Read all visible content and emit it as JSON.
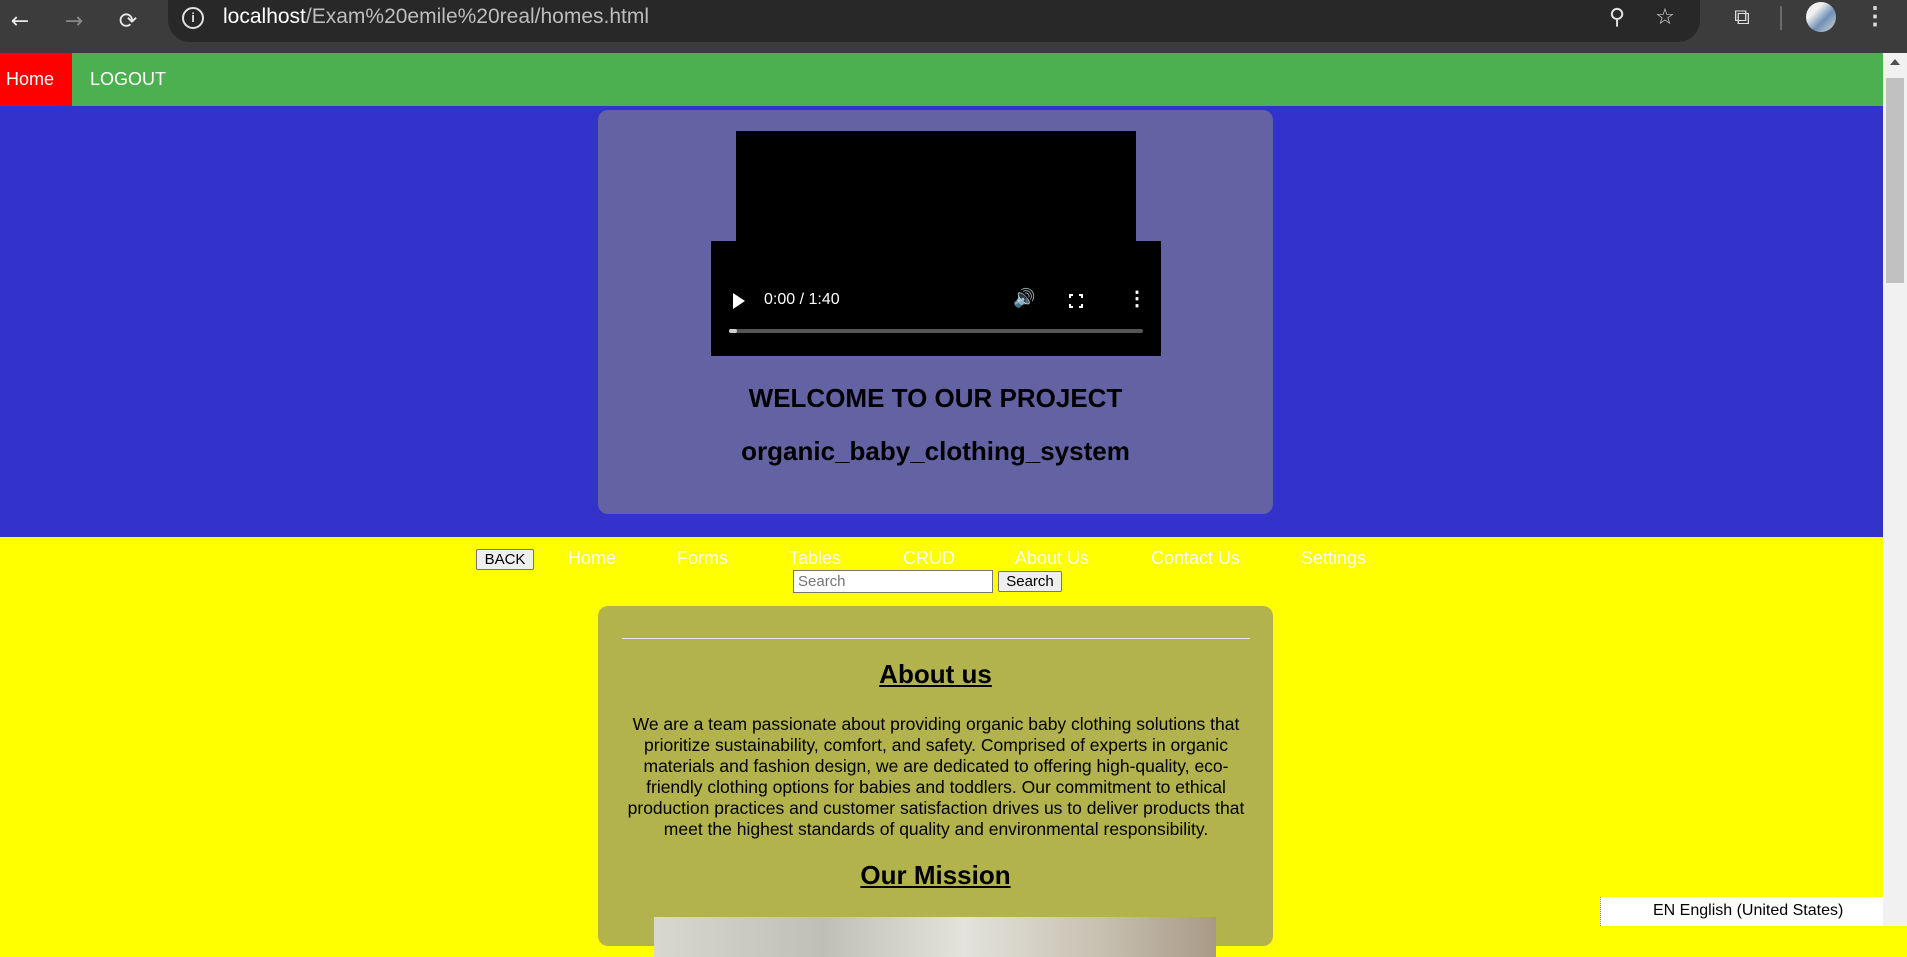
{
  "browser": {
    "back_icon": "←",
    "forward_icon": "→",
    "reload_icon": "⟳",
    "info_icon": "i",
    "url_host": "localhost",
    "url_path": "/Exam%20emile%20real/homes.html",
    "zoom_icon": "⚲",
    "star_icon": "☆",
    "extensions_icon": "⧉",
    "menu_icon": "⋮"
  },
  "top_nav": {
    "home": "Home",
    "logout": "LOGOUT"
  },
  "hero": {
    "video": {
      "time": "0:00 / 1:40",
      "volume_icon": "🔊",
      "more_icon": "⋮",
      "progress": 0.02
    },
    "title": "WELCOME TO OUR PROJECT",
    "subtitle": "organic_baby_clothing_system"
  },
  "sub_nav": {
    "back": "BACK",
    "links": [
      "Home",
      "Forms",
      "Tables",
      "CRUD",
      "About Us",
      "Contact Us",
      "Settings"
    ]
  },
  "search": {
    "placeholder": "Search",
    "value": "",
    "button": "Search"
  },
  "about": {
    "heading": "About us",
    "text": "We are a team passionate about providing organic baby clothing solutions that prioritize sustainability, comfort, and safety. Comprised of experts in organic materials and fashion design, we are dedicated to offering high-quality, eco-friendly clothing options for babies and toddlers. Our commitment to ethical production practices and customer satisfaction drives us to deliver products that meet the highest standards of quality and environmental responsibility.",
    "mission_heading": "Our Mission"
  },
  "language_bar": {
    "label": "EN English (United States)"
  },
  "colors": {
    "top_nav_bg": "#4caf50",
    "home_active_bg": "#ff0000",
    "hero_bg": "#3333cc",
    "hero_card_bg": "#6363a3",
    "page_bg": "#ffff00",
    "about_card_bg": "#b3b34d"
  }
}
